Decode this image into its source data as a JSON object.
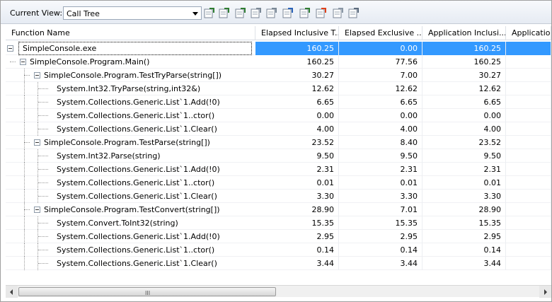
{
  "toolbar": {
    "label": "Current View:",
    "view_value": "Call Tree",
    "icons": [
      "export-icon",
      "export-selection-icon",
      "show-source-icon",
      "filter-icon",
      "find-icon",
      "compare-icon",
      "report-icon",
      "hot-path-icon",
      "noise-reduction-icon",
      "properties-icon"
    ]
  },
  "columns": [
    "Function Name",
    "Elapsed Inclusive T...",
    "Elapsed Exclusive ...",
    "Application Inclusi...",
    "Applicatio"
  ],
  "rows": [
    {
      "name": "SimpleConsole.exe",
      "v1": "160.25",
      "v2": "0.00",
      "v3": "160.25",
      "level": 0,
      "expandable": true,
      "selected": true
    },
    {
      "name": "SimpleConsole.Program.Main()",
      "v1": "160.25",
      "v2": "77.56",
      "v3": "160.25",
      "level": 1,
      "expandable": true
    },
    {
      "name": "SimpleConsole.Program.TestTryParse(string[])",
      "v1": "30.27",
      "v2": "7.00",
      "v3": "30.27",
      "level": 2,
      "expandable": true
    },
    {
      "name": "System.Int32.TryParse(string,int32&)",
      "v1": "12.62",
      "v2": "12.62",
      "v3": "12.62",
      "level": 3
    },
    {
      "name": "System.Collections.Generic.List`1.Add(!0)",
      "v1": "6.65",
      "v2": "6.65",
      "v3": "6.65",
      "level": 3
    },
    {
      "name": "System.Collections.Generic.List`1..ctor()",
      "v1": "0.00",
      "v2": "0.00",
      "v3": "0.00",
      "level": 3
    },
    {
      "name": "System.Collections.Generic.List`1.Clear()",
      "v1": "4.00",
      "v2": "4.00",
      "v3": "4.00",
      "level": 3
    },
    {
      "name": "SimpleConsole.Program.TestParse(string[])",
      "v1": "23.52",
      "v2": "8.40",
      "v3": "23.52",
      "level": 2,
      "expandable": true
    },
    {
      "name": "System.Int32.Parse(string)",
      "v1": "9.50",
      "v2": "9.50",
      "v3": "9.50",
      "level": 3
    },
    {
      "name": "System.Collections.Generic.List`1.Add(!0)",
      "v1": "2.31",
      "v2": "2.31",
      "v3": "2.31",
      "level": 3
    },
    {
      "name": "System.Collections.Generic.List`1..ctor()",
      "v1": "0.01",
      "v2": "0.01",
      "v3": "0.01",
      "level": 3
    },
    {
      "name": "System.Collections.Generic.List`1.Clear()",
      "v1": "3.30",
      "v2": "3.30",
      "v3": "3.30",
      "level": 3
    },
    {
      "name": "SimpleConsole.Program.TestConvert(string[])",
      "v1": "28.90",
      "v2": "7.01",
      "v3": "28.90",
      "level": 2,
      "expandable": true
    },
    {
      "name": "System.Convert.ToInt32(string)",
      "v1": "15.35",
      "v2": "15.35",
      "v3": "15.35",
      "level": 3
    },
    {
      "name": "System.Collections.Generic.List`1.Add(!0)",
      "v1": "2.95",
      "v2": "2.95",
      "v3": "2.95",
      "level": 3
    },
    {
      "name": "System.Collections.Generic.List`1..ctor()",
      "v1": "0.14",
      "v2": "0.14",
      "v3": "0.14",
      "level": 3
    },
    {
      "name": "System.Collections.Generic.List`1.Clear()",
      "v1": "3.44",
      "v2": "3.44",
      "v3": "3.44",
      "level": 3
    }
  ],
  "scrollbar": {
    "grip": "III"
  },
  "colors": {
    "selection": "#3399ff"
  }
}
